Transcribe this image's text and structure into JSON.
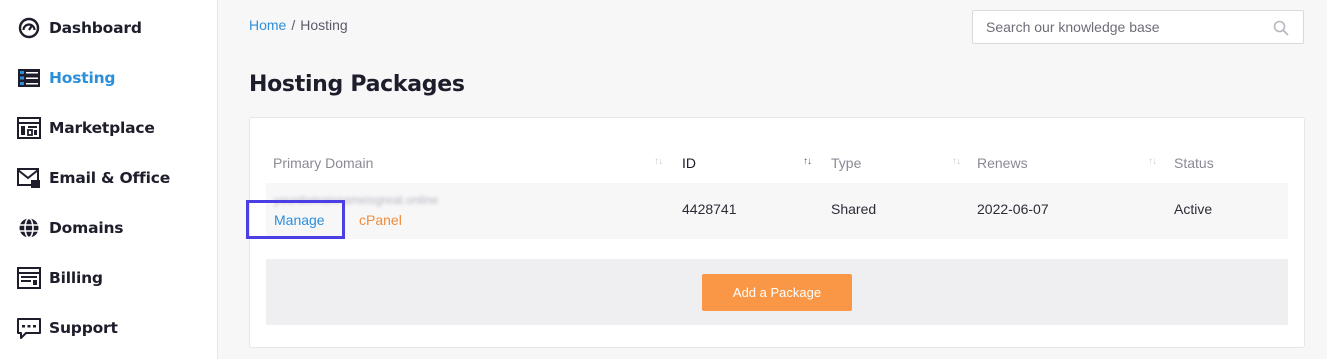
{
  "sidebar": {
    "items": [
      {
        "label": "Dashboard",
        "icon": "dashboard-gauge-icon",
        "active": false
      },
      {
        "label": "Hosting",
        "icon": "server-stack-icon",
        "active": true
      },
      {
        "label": "Marketplace",
        "icon": "marketplace-layout-icon",
        "active": false
      },
      {
        "label": "Email & Office",
        "icon": "envelope-icon",
        "active": false
      },
      {
        "label": "Domains",
        "icon": "globe-icon",
        "active": false
      },
      {
        "label": "Billing",
        "icon": "invoice-icon",
        "active": false
      },
      {
        "label": "Support",
        "icon": "chat-support-icon",
        "active": false
      }
    ]
  },
  "breadcrumb": {
    "home": "Home",
    "separator": "/",
    "current": "Hosting"
  },
  "search": {
    "placeholder": "Search our knowledge base",
    "value": ""
  },
  "page": {
    "title": "Hosting Packages"
  },
  "table": {
    "columns": [
      "Primary Domain",
      "ID",
      "Type",
      "Renews",
      "Status"
    ],
    "sorted_column": "ID",
    "rows": [
      {
        "domain": "yourdomainnameisgreat.online",
        "id": "4428741",
        "type": "Shared",
        "renews": "2022-06-07",
        "status": "Active",
        "manage_label": "Manage",
        "cpanel_label": "cPanel"
      }
    ]
  },
  "actions": {
    "add_package_label": "Add a Package"
  },
  "colors": {
    "accent": "#2b8fdb",
    "orange": "#f99746",
    "highlight": "#4b3fe3"
  }
}
